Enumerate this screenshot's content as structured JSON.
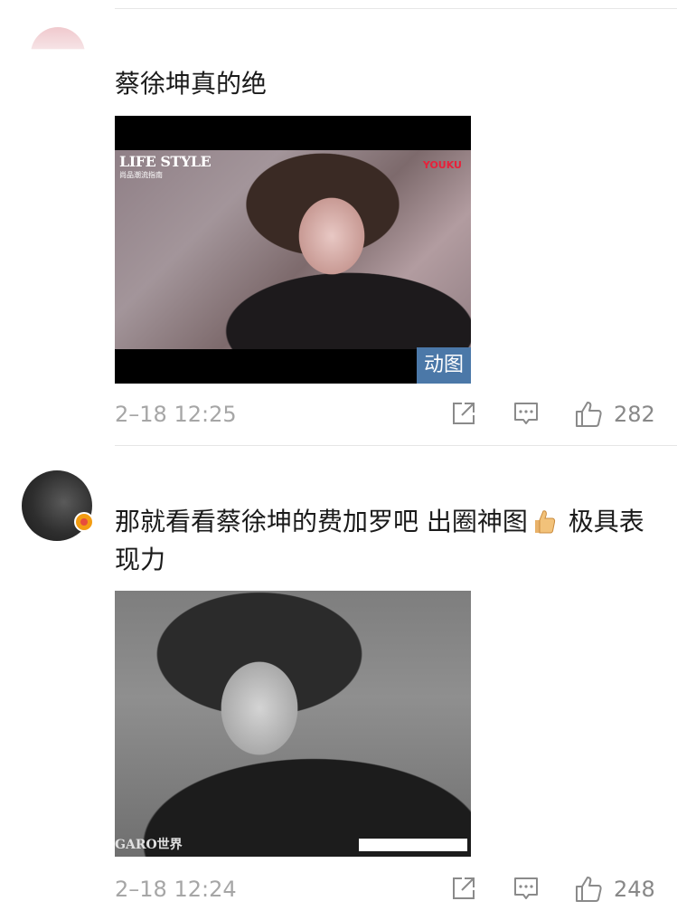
{
  "comments": [
    {
      "username": "",
      "text": "蔡徐坤真的绝",
      "media": {
        "kind": "gif",
        "brand": "LIFE STYLE",
        "brand_sub": "尚品潮流指南",
        "watermark": "YOUKU",
        "badge_label": "动图"
      },
      "timestamp": "2–18 12:25",
      "like_count": "282"
    },
    {
      "username": "",
      "text_before_emoji": "那就看看蔡徐坤的费加罗吧 出圈神图",
      "emoji": "thumbs-up",
      "text_after_emoji": " 极具表现力",
      "media": {
        "kind": "image",
        "watermark_left": "GARO世界"
      },
      "timestamp": "2–18 12:24",
      "like_count": "248"
    }
  ],
  "icons": {
    "share": "share-icon",
    "comment": "comment-icon",
    "like": "thumbs-up-icon"
  },
  "colors": {
    "gif_badge": "#4b78a8",
    "username": "#f08a2a",
    "meta_text": "#a6a6a6"
  }
}
